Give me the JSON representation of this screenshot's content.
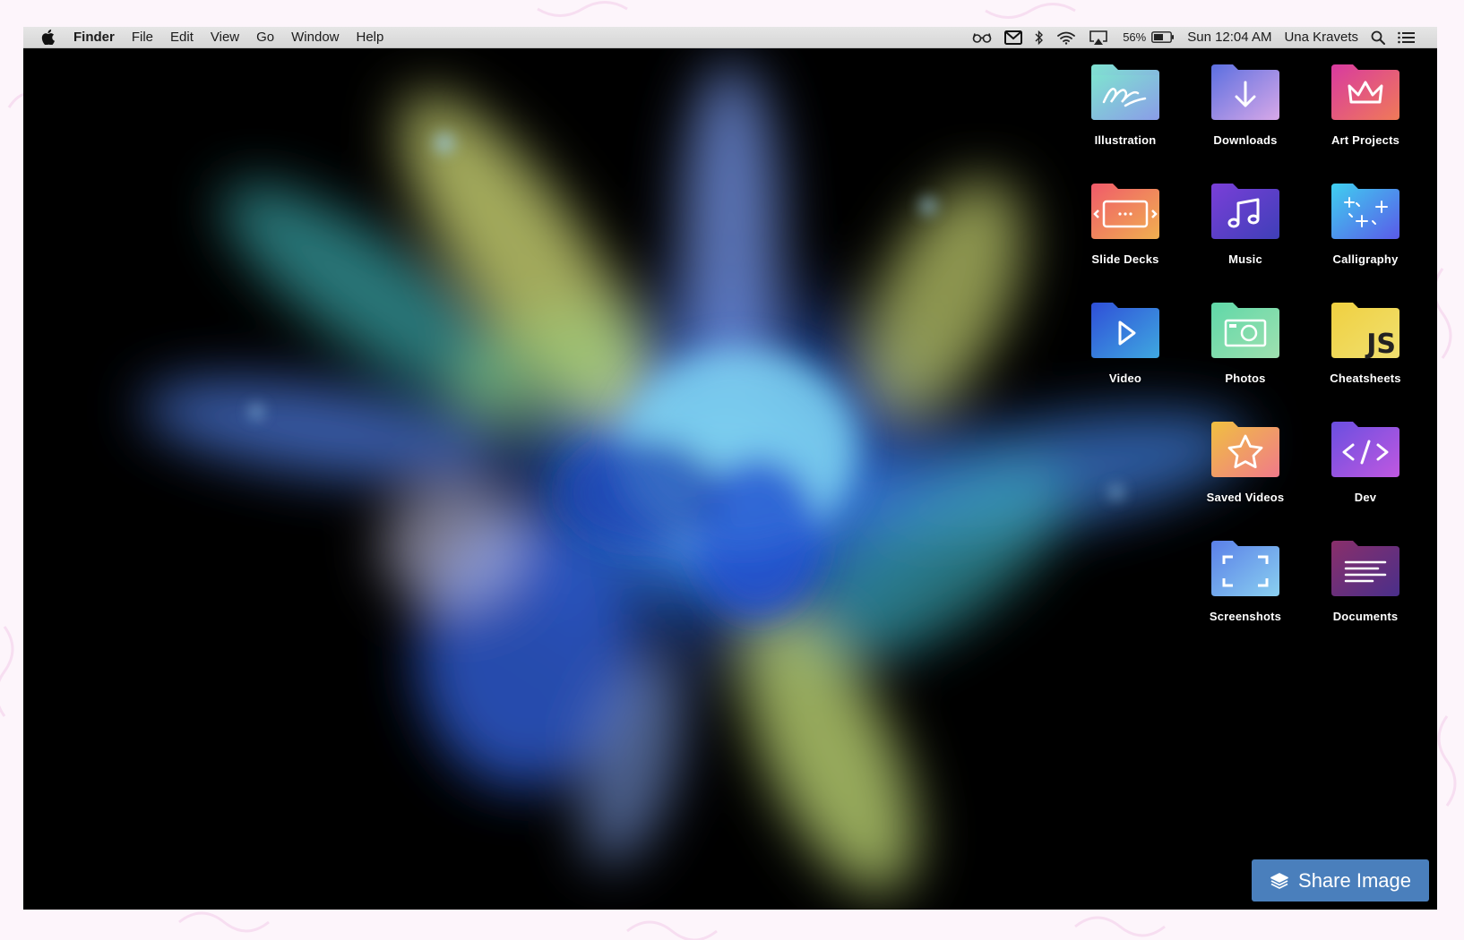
{
  "menubar": {
    "app_name": "Finder",
    "menus": [
      "File",
      "Edit",
      "View",
      "Go",
      "Window",
      "Help"
    ],
    "battery_percent": "56%",
    "clock": "Sun 12:04 AM",
    "user_name": "Una Kravets",
    "icons": [
      "apple-icon",
      "glasses-icon",
      "mail-icon",
      "bluetooth-icon",
      "wifi-icon",
      "airplay-icon",
      "battery-icon",
      "spotlight-search-icon",
      "notification-list-icon"
    ]
  },
  "desktop": {
    "folders": [
      {
        "label": "Illustration",
        "icon": "scribble-icon",
        "color": "#6fd6c8"
      },
      {
        "label": "Downloads",
        "icon": "arrow-down-icon",
        "color": "#7b7fe0"
      },
      {
        "label": "Art Projects",
        "icon": "crown-icon",
        "color": "#e0548a"
      },
      {
        "label": "Slide Decks",
        "icon": "slides-icon",
        "color": "#f07a58"
      },
      {
        "label": "Music",
        "icon": "music-note-icon",
        "color": "#5b3fc4"
      },
      {
        "label": "Calligraphy",
        "icon": "sparkle-icon",
        "color": "#3aa6f0"
      },
      {
        "label": "Video",
        "icon": "play-icon",
        "color": "#2f5fd8"
      },
      {
        "label": "Photos",
        "icon": "camera-icon",
        "color": "#5fcf9e"
      },
      {
        "label": "Cheatsheets",
        "icon": "js-icon",
        "color": "#f2d64a"
      },
      {
        "label": "Saved Videos",
        "icon": "star-icon",
        "color": "#f0a858"
      },
      {
        "label": "Dev",
        "icon": "code-icon",
        "color": "#8a5fe0"
      },
      {
        "label": "Screenshots",
        "icon": "crop-frame-icon",
        "color": "#5f8be8"
      },
      {
        "label": "Documents",
        "icon": "text-lines-icon",
        "color": "#7a2f7a"
      }
    ]
  },
  "share": {
    "label": "Share Image",
    "color": "#4a7fbc"
  }
}
